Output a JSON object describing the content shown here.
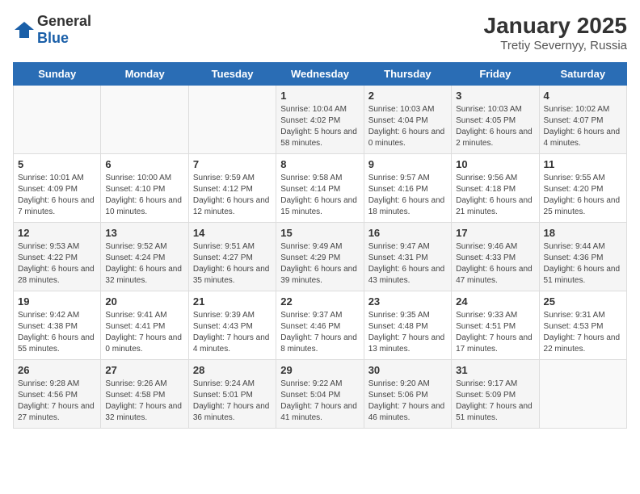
{
  "logo": {
    "general": "General",
    "blue": "Blue"
  },
  "title": "January 2025",
  "subtitle": "Tretiy Severnyy, Russia",
  "weekdays": [
    "Sunday",
    "Monday",
    "Tuesday",
    "Wednesday",
    "Thursday",
    "Friday",
    "Saturday"
  ],
  "weeks": [
    [
      {
        "day": "",
        "info": ""
      },
      {
        "day": "",
        "info": ""
      },
      {
        "day": "",
        "info": ""
      },
      {
        "day": "1",
        "info": "Sunrise: 10:04 AM\nSunset: 4:02 PM\nDaylight: 5 hours and 58 minutes."
      },
      {
        "day": "2",
        "info": "Sunrise: 10:03 AM\nSunset: 4:04 PM\nDaylight: 6 hours and 0 minutes."
      },
      {
        "day": "3",
        "info": "Sunrise: 10:03 AM\nSunset: 4:05 PM\nDaylight: 6 hours and 2 minutes."
      },
      {
        "day": "4",
        "info": "Sunrise: 10:02 AM\nSunset: 4:07 PM\nDaylight: 6 hours and 4 minutes."
      }
    ],
    [
      {
        "day": "5",
        "info": "Sunrise: 10:01 AM\nSunset: 4:09 PM\nDaylight: 6 hours and 7 minutes."
      },
      {
        "day": "6",
        "info": "Sunrise: 10:00 AM\nSunset: 4:10 PM\nDaylight: 6 hours and 10 minutes."
      },
      {
        "day": "7",
        "info": "Sunrise: 9:59 AM\nSunset: 4:12 PM\nDaylight: 6 hours and 12 minutes."
      },
      {
        "day": "8",
        "info": "Sunrise: 9:58 AM\nSunset: 4:14 PM\nDaylight: 6 hours and 15 minutes."
      },
      {
        "day": "9",
        "info": "Sunrise: 9:57 AM\nSunset: 4:16 PM\nDaylight: 6 hours and 18 minutes."
      },
      {
        "day": "10",
        "info": "Sunrise: 9:56 AM\nSunset: 4:18 PM\nDaylight: 6 hours and 21 minutes."
      },
      {
        "day": "11",
        "info": "Sunrise: 9:55 AM\nSunset: 4:20 PM\nDaylight: 6 hours and 25 minutes."
      }
    ],
    [
      {
        "day": "12",
        "info": "Sunrise: 9:53 AM\nSunset: 4:22 PM\nDaylight: 6 hours and 28 minutes."
      },
      {
        "day": "13",
        "info": "Sunrise: 9:52 AM\nSunset: 4:24 PM\nDaylight: 6 hours and 32 minutes."
      },
      {
        "day": "14",
        "info": "Sunrise: 9:51 AM\nSunset: 4:27 PM\nDaylight: 6 hours and 35 minutes."
      },
      {
        "day": "15",
        "info": "Sunrise: 9:49 AM\nSunset: 4:29 PM\nDaylight: 6 hours and 39 minutes."
      },
      {
        "day": "16",
        "info": "Sunrise: 9:47 AM\nSunset: 4:31 PM\nDaylight: 6 hours and 43 minutes."
      },
      {
        "day": "17",
        "info": "Sunrise: 9:46 AM\nSunset: 4:33 PM\nDaylight: 6 hours and 47 minutes."
      },
      {
        "day": "18",
        "info": "Sunrise: 9:44 AM\nSunset: 4:36 PM\nDaylight: 6 hours and 51 minutes."
      }
    ],
    [
      {
        "day": "19",
        "info": "Sunrise: 9:42 AM\nSunset: 4:38 PM\nDaylight: 6 hours and 55 minutes."
      },
      {
        "day": "20",
        "info": "Sunrise: 9:41 AM\nSunset: 4:41 PM\nDaylight: 7 hours and 0 minutes."
      },
      {
        "day": "21",
        "info": "Sunrise: 9:39 AM\nSunset: 4:43 PM\nDaylight: 7 hours and 4 minutes."
      },
      {
        "day": "22",
        "info": "Sunrise: 9:37 AM\nSunset: 4:46 PM\nDaylight: 7 hours and 8 minutes."
      },
      {
        "day": "23",
        "info": "Sunrise: 9:35 AM\nSunset: 4:48 PM\nDaylight: 7 hours and 13 minutes."
      },
      {
        "day": "24",
        "info": "Sunrise: 9:33 AM\nSunset: 4:51 PM\nDaylight: 7 hours and 17 minutes."
      },
      {
        "day": "25",
        "info": "Sunrise: 9:31 AM\nSunset: 4:53 PM\nDaylight: 7 hours and 22 minutes."
      }
    ],
    [
      {
        "day": "26",
        "info": "Sunrise: 9:28 AM\nSunset: 4:56 PM\nDaylight: 7 hours and 27 minutes."
      },
      {
        "day": "27",
        "info": "Sunrise: 9:26 AM\nSunset: 4:58 PM\nDaylight: 7 hours and 32 minutes."
      },
      {
        "day": "28",
        "info": "Sunrise: 9:24 AM\nSunset: 5:01 PM\nDaylight: 7 hours and 36 minutes."
      },
      {
        "day": "29",
        "info": "Sunrise: 9:22 AM\nSunset: 5:04 PM\nDaylight: 7 hours and 41 minutes."
      },
      {
        "day": "30",
        "info": "Sunrise: 9:20 AM\nSunset: 5:06 PM\nDaylight: 7 hours and 46 minutes."
      },
      {
        "day": "31",
        "info": "Sunrise: 9:17 AM\nSunset: 5:09 PM\nDaylight: 7 hours and 51 minutes."
      },
      {
        "day": "",
        "info": ""
      }
    ]
  ]
}
